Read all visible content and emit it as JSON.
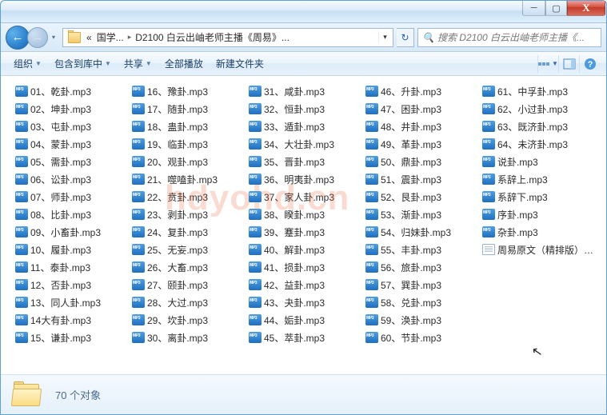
{
  "titlebar": {
    "min": "─",
    "max": "▢",
    "close": "X"
  },
  "nav": {
    "back": "←",
    "fwd": "→",
    "dd": "▾"
  },
  "address": {
    "pre": "«",
    "crumb1": "国学...",
    "sep": "▸",
    "crumb2": "D2100 白云出岫老师主播《周易》...",
    "dd": "▾",
    "refresh": "↻"
  },
  "search": {
    "icon": "🔍",
    "placeholder": "搜索 D2100 白云出岫老师主播《..."
  },
  "toolbar": {
    "organize": "组织",
    "include": "包含到库中",
    "share": "共享",
    "playall": "全部播放",
    "newfolder": "新建文件夹",
    "dd": "▼",
    "help": "?"
  },
  "files": [
    {
      "n": "01、乾卦.mp3",
      "t": "mp3"
    },
    {
      "n": "02、坤卦.mp3",
      "t": "mp3"
    },
    {
      "n": "03、屯卦.mp3",
      "t": "mp3"
    },
    {
      "n": "04、蒙卦.mp3",
      "t": "mp3"
    },
    {
      "n": "05、需卦.mp3",
      "t": "mp3"
    },
    {
      "n": "06、讼卦.mp3",
      "t": "mp3"
    },
    {
      "n": "07、师卦.mp3",
      "t": "mp3"
    },
    {
      "n": "08、比卦.mp3",
      "t": "mp3"
    },
    {
      "n": "09、小畜卦.mp3",
      "t": "mp3"
    },
    {
      "n": "10、履卦.mp3",
      "t": "mp3"
    },
    {
      "n": "11、泰卦.mp3",
      "t": "mp3"
    },
    {
      "n": "12、否卦.mp3",
      "t": "mp3"
    },
    {
      "n": "13、同人卦.mp3",
      "t": "mp3"
    },
    {
      "n": "14大有卦.mp3",
      "t": "mp3"
    },
    {
      "n": "15、谦卦.mp3",
      "t": "mp3"
    },
    {
      "n": "16、豫卦.mp3",
      "t": "mp3"
    },
    {
      "n": "17、随卦.mp3",
      "t": "mp3"
    },
    {
      "n": "18、蛊卦.mp3",
      "t": "mp3"
    },
    {
      "n": "19、临卦.mp3",
      "t": "mp3"
    },
    {
      "n": "20、观卦.mp3",
      "t": "mp3"
    },
    {
      "n": "21、噬嗑卦.mp3",
      "t": "mp3"
    },
    {
      "n": "22、贲卦.mp3",
      "t": "mp3"
    },
    {
      "n": "23、剥卦.mp3",
      "t": "mp3"
    },
    {
      "n": "24、复卦.mp3",
      "t": "mp3"
    },
    {
      "n": "25、无妄.mp3",
      "t": "mp3"
    },
    {
      "n": "26、大畜.mp3",
      "t": "mp3"
    },
    {
      "n": "27、颐卦.mp3",
      "t": "mp3"
    },
    {
      "n": "28、大过.mp3",
      "t": "mp3"
    },
    {
      "n": "29、坎卦.mp3",
      "t": "mp3"
    },
    {
      "n": "30、离卦.mp3",
      "t": "mp3"
    },
    {
      "n": "31、咸卦.mp3",
      "t": "mp3"
    },
    {
      "n": "32、恒卦.mp3",
      "t": "mp3"
    },
    {
      "n": "33、遁卦.mp3",
      "t": "mp3"
    },
    {
      "n": "34、大壮卦.mp3",
      "t": "mp3"
    },
    {
      "n": "35、晋卦.mp3",
      "t": "mp3"
    },
    {
      "n": "36、明夷卦.mp3",
      "t": "mp3"
    },
    {
      "n": "37、家人卦.mp3",
      "t": "mp3"
    },
    {
      "n": "38、睽卦.mp3",
      "t": "mp3"
    },
    {
      "n": "39、蹇卦.mp3",
      "t": "mp3"
    },
    {
      "n": "40、解卦.mp3",
      "t": "mp3"
    },
    {
      "n": "41、损卦.mp3",
      "t": "mp3"
    },
    {
      "n": "42、益卦.mp3",
      "t": "mp3"
    },
    {
      "n": "43、夬卦.mp3",
      "t": "mp3"
    },
    {
      "n": "44、姤卦.mp3",
      "t": "mp3"
    },
    {
      "n": "45、萃卦.mp3",
      "t": "mp3"
    },
    {
      "n": "46、升卦.mp3",
      "t": "mp3"
    },
    {
      "n": "47、困卦.mp3",
      "t": "mp3"
    },
    {
      "n": "48、井卦.mp3",
      "t": "mp3"
    },
    {
      "n": "49、革卦.mp3",
      "t": "mp3"
    },
    {
      "n": "50、鼎卦.mp3",
      "t": "mp3"
    },
    {
      "n": "51、震卦.mp3",
      "t": "mp3"
    },
    {
      "n": "52、艮卦.mp3",
      "t": "mp3"
    },
    {
      "n": "53、渐卦.mp3",
      "t": "mp3"
    },
    {
      "n": "54、归妹卦.mp3",
      "t": "mp3"
    },
    {
      "n": "55、丰卦.mp3",
      "t": "mp3"
    },
    {
      "n": "56、旅卦.mp3",
      "t": "mp3"
    },
    {
      "n": "57、巽卦.mp3",
      "t": "mp3"
    },
    {
      "n": "58、兑卦.mp3",
      "t": "mp3"
    },
    {
      "n": "59、涣卦.mp3",
      "t": "mp3"
    },
    {
      "n": "60、节卦.mp3",
      "t": "mp3"
    },
    {
      "n": "61、中孚卦.mp3",
      "t": "mp3"
    },
    {
      "n": "62、小过卦.mp3",
      "t": "mp3"
    },
    {
      "n": "63、既济卦.mp3",
      "t": "mp3"
    },
    {
      "n": "64、未济卦.mp3",
      "t": "mp3"
    },
    {
      "n": "说卦.mp3",
      "t": "mp3"
    },
    {
      "n": "系辞上.mp3",
      "t": "mp3"
    },
    {
      "n": "系辞下.mp3",
      "t": "mp3"
    },
    {
      "n": "序卦.mp3",
      "t": "mp3"
    },
    {
      "n": "杂卦.mp3",
      "t": "mp3"
    },
    {
      "n": "周易原文（精排版）.doc",
      "t": "doc"
    }
  ],
  "status": {
    "count": "70 个对象"
  },
  "watermark": "hdyohd.cn"
}
